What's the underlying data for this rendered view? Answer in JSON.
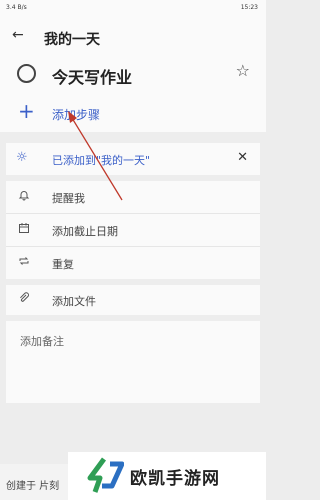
{
  "status_bar": {
    "left": "3.4 B/s",
    "right": "15:23"
  },
  "header": {
    "back_icon": "arrow-left-icon",
    "title": "我的一天"
  },
  "task": {
    "name": "今天写作业"
  },
  "add_step": {
    "label": "添加步骤"
  },
  "my_day_card": {
    "text": "已添加到\"我的一天\""
  },
  "actions": [
    {
      "icon": "bell-icon",
      "label": "提醒我"
    },
    {
      "icon": "calendar-icon",
      "label": "添加截止日期"
    },
    {
      "icon": "repeat-icon",
      "label": "重复"
    }
  ],
  "attach": {
    "icon": "paperclip-icon",
    "label": "添加文件"
  },
  "note": {
    "placeholder": "添加备注"
  },
  "footer": {
    "created": "创建于 片刻"
  },
  "watermark": {
    "text": "欧凯手游网"
  },
  "colors": {
    "accent": "#3a5fc8",
    "background": "#ededed",
    "card": "#fafafa",
    "annotation_arrow": "#c0392b",
    "logo_green": "#2f9e55",
    "logo_blue": "#2b6fc2"
  }
}
